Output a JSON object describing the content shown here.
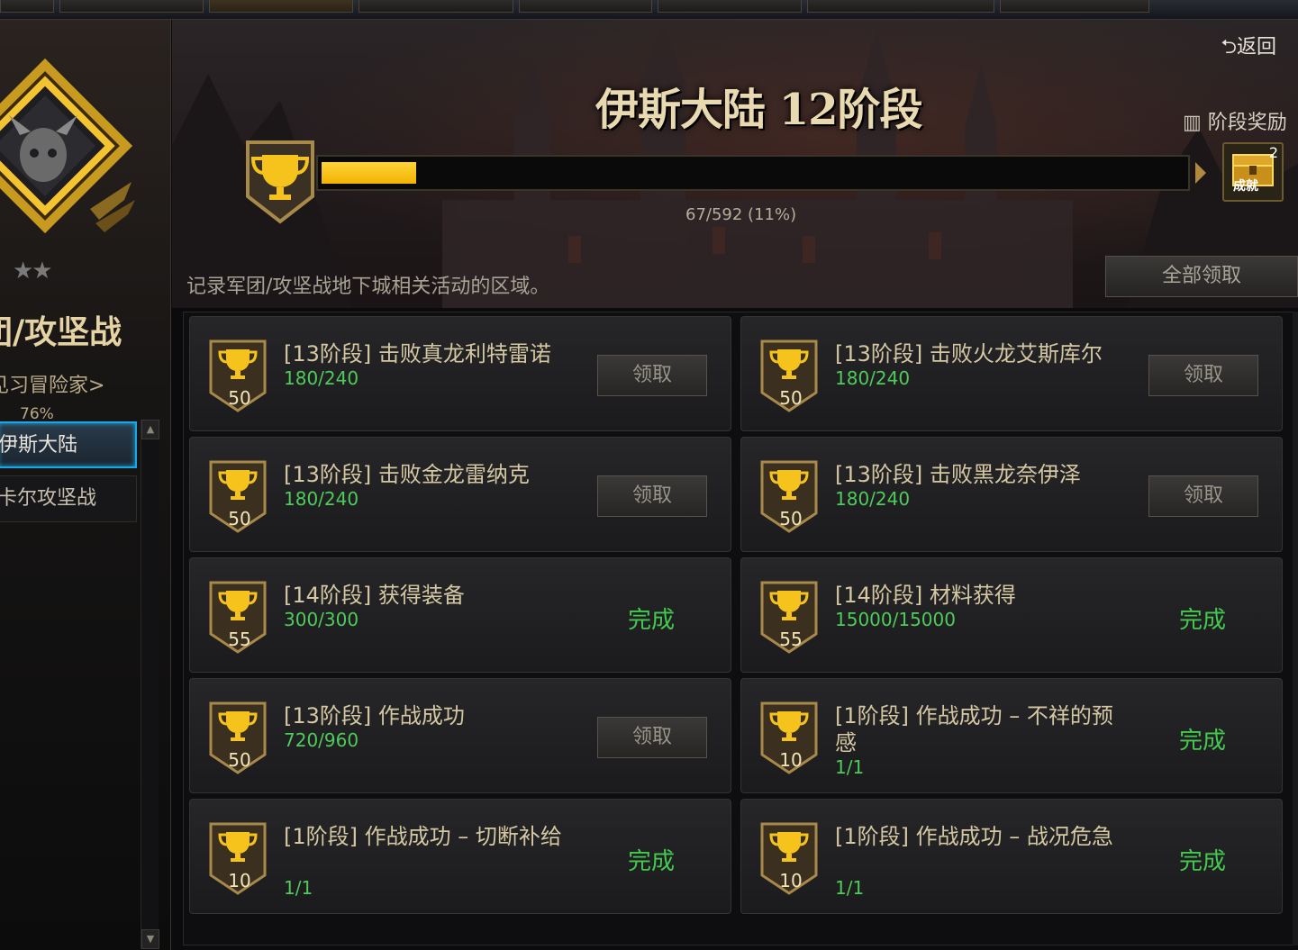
{
  "top_tabs": [
    "",
    "",
    "",
    "",
    "",
    "",
    "",
    "",
    ""
  ],
  "sidebar": {
    "category_title": "团/攻坚战",
    "rank_name": "见习冒险家>",
    "rank_percent": "76%",
    "stars": "★★",
    "items": [
      {
        "label": "伊斯大陆",
        "active": true
      },
      {
        "label": "卡尔攻坚战",
        "active": false
      }
    ]
  },
  "header": {
    "back_label": "返回",
    "stage_title": "伊斯大陆 12阶段",
    "stage_reward_label": "阶段奖励",
    "reward_count": "2",
    "reward_item_text": "成就",
    "progress_text": "67/592 (11%)",
    "progress_fraction": 0.11,
    "description": "记录军团/攻坚战地下城相关活动的区域。",
    "claim_all_label": "全部领取"
  },
  "achievements": [
    {
      "points": "50",
      "title": "[13阶段] 击败真龙利特雷诺",
      "progress": "180/240",
      "status": "claim",
      "status_label": "领取"
    },
    {
      "points": "50",
      "title": "[13阶段] 击败火龙艾斯库尔",
      "progress": "180/240",
      "status": "claim",
      "status_label": "领取"
    },
    {
      "points": "50",
      "title": "[13阶段] 击败金龙雷纳克",
      "progress": "180/240",
      "status": "claim",
      "status_label": "领取"
    },
    {
      "points": "50",
      "title": "[13阶段] 击败黑龙奈伊泽",
      "progress": "180/240",
      "status": "claim",
      "status_label": "领取"
    },
    {
      "points": "55",
      "title": "[14阶段] 获得装备",
      "progress": "300/300",
      "status": "done",
      "status_label": "完成"
    },
    {
      "points": "55",
      "title": "[14阶段] 材料获得",
      "progress": "15000/15000",
      "status": "done",
      "status_label": "完成"
    },
    {
      "points": "50",
      "title": "[13阶段] 作战成功",
      "progress": "720/960",
      "status": "claim",
      "status_label": "领取"
    },
    {
      "points": "10",
      "title": "[1阶段] 作战成功 – 不祥的预感",
      "progress": "1/1",
      "status": "done",
      "status_label": "完成"
    },
    {
      "points": "10",
      "title": "[1阶段] 作战成功 – 切断补给",
      "progress": "1/1",
      "status": "done",
      "status_label": "完成"
    },
    {
      "points": "10",
      "title": "[1阶段] 作战成功 – 战况危急",
      "progress": "1/1",
      "status": "done",
      "status_label": "完成"
    }
  ],
  "colors": {
    "progress_fill": "#f5c21a",
    "done_text": "#43c94f",
    "progress_text": "#4ecb5a",
    "active_border": "#1aa7e6"
  },
  "icons": {
    "back": "return-arrow-icon",
    "trophy": "trophy-icon",
    "reward": "chest-icon",
    "emblem": "demon-emblem-icon"
  }
}
